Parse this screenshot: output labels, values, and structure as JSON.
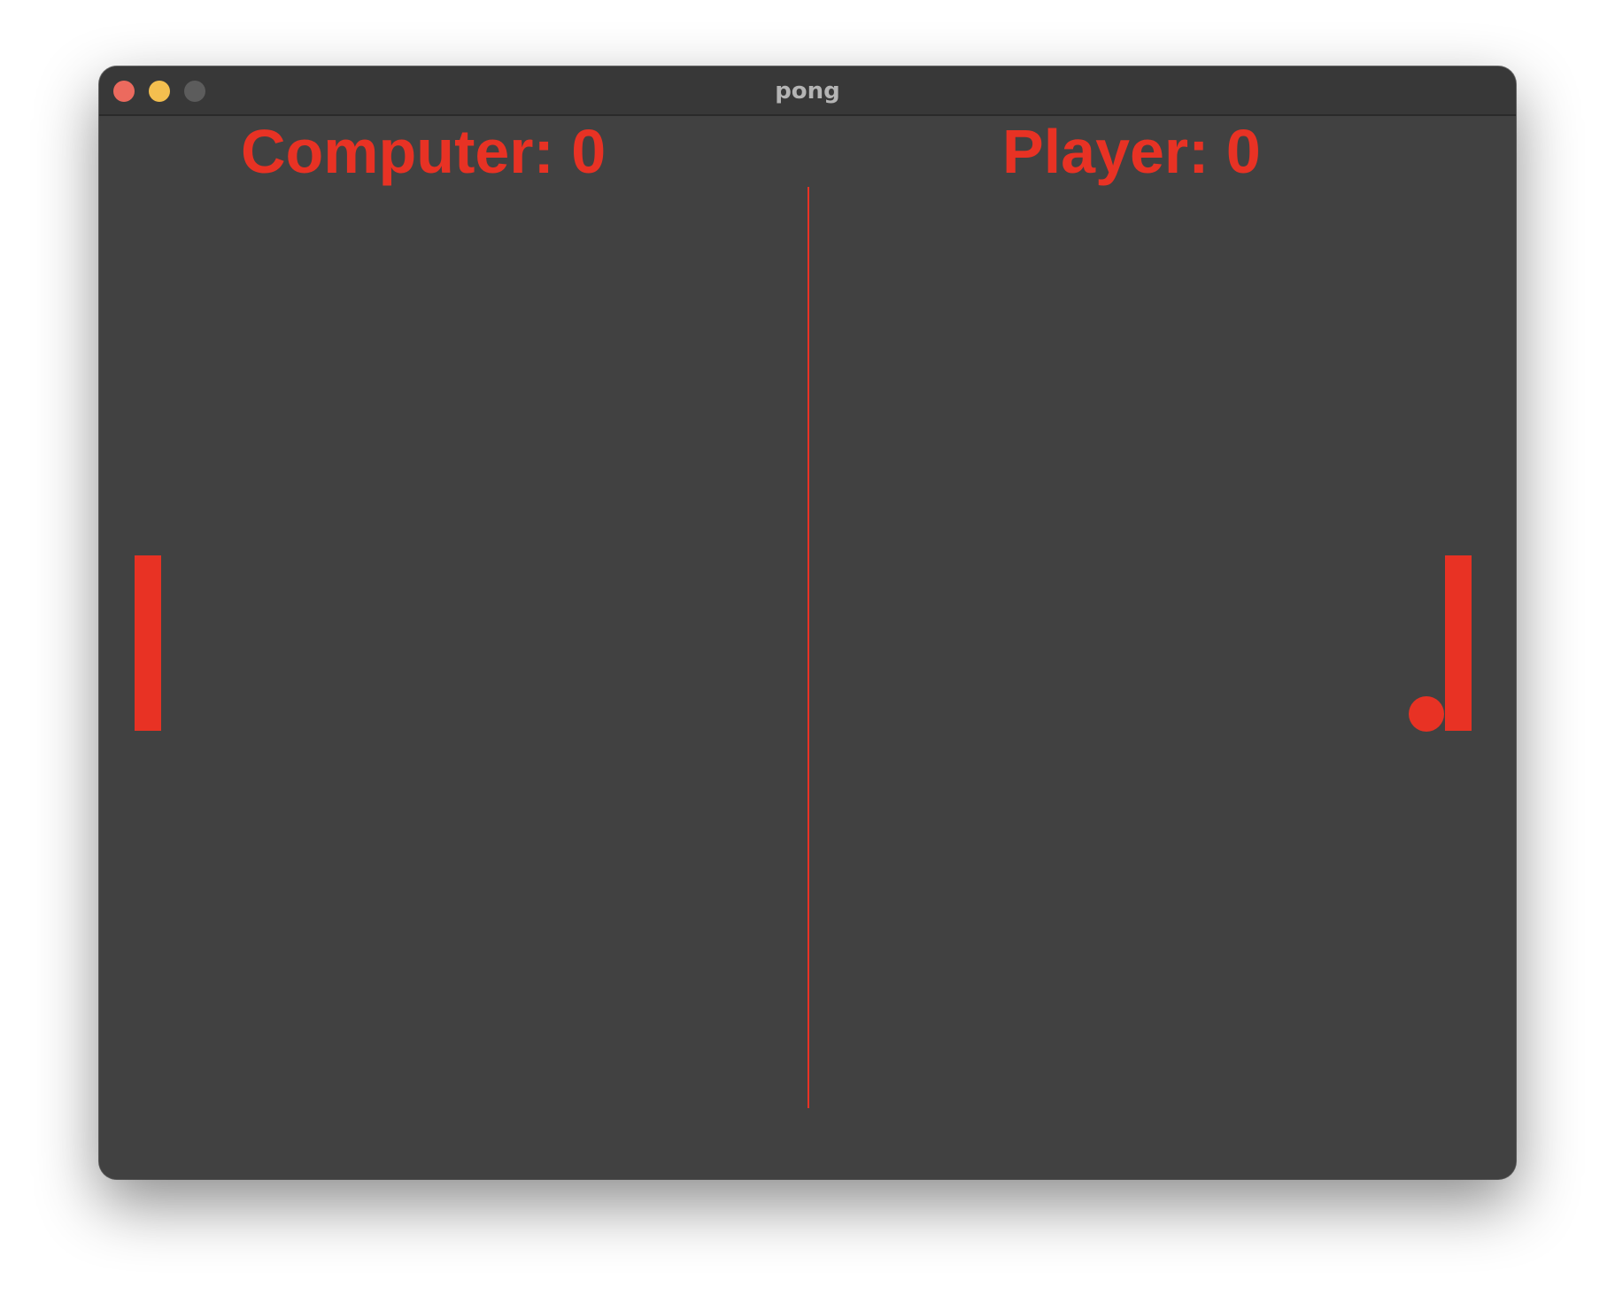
{
  "window": {
    "title": "pong"
  },
  "scores": {
    "computer_label": "Computer: 0",
    "player_label": "Player: 0",
    "computer": 0,
    "player": 0
  },
  "colors": {
    "game_red": "#e83224",
    "background": "#414141",
    "titlebar": "#383838",
    "close": "#ec6a5e",
    "minimize": "#f4bf4f",
    "zoom_inactive": "#5c5c5c"
  }
}
